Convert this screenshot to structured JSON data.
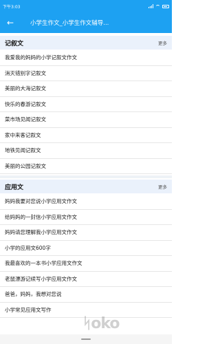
{
  "status": {
    "time": "下午3:03"
  },
  "header": {
    "title": "小学生作文_小学生作文辅导..."
  },
  "sections": [
    {
      "title": "记叙文",
      "more": "更多",
      "items": [
        "我爱我的妈妈的小学记叙文作文",
        "消灭错别字记叙文",
        "美丽的大海记叙文",
        "快乐的春游记叙文",
        "菜市场见闻记叙文",
        "家中来客记叙文",
        "地铁见闻记叙文",
        "美丽的公园记叙文"
      ]
    },
    {
      "title": "应用文",
      "more": "更多",
      "items": [
        "妈妈我要对您说小学应用文作文",
        "给妈妈的一封信小学应用文作文",
        "妈妈请您理解我小学应用文作文",
        "小学的应用文600字",
        "我最喜欢的一本书小学应用文作文",
        "老鼠漂游记续写小学应用文作文",
        "爸爸，妈妈，我想对您说",
        "小学常见应用文写作"
      ]
    }
  ],
  "watermark": "ᛋoko"
}
